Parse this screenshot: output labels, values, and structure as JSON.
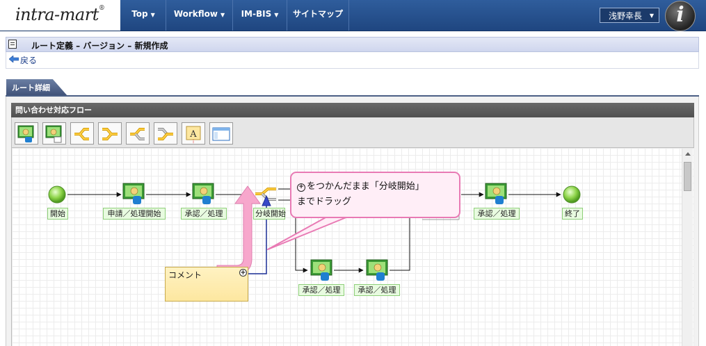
{
  "header": {
    "logo_text": "intra-mart",
    "nav": [
      {
        "label": "Top"
      },
      {
        "label": "Workflow"
      },
      {
        "label": "IM-BIS"
      },
      {
        "label": "サイトマップ"
      }
    ],
    "user_name": "浅野幸長",
    "avatar_letter": "i"
  },
  "page": {
    "title": "ルート定義 – バージョン – 新規作成",
    "back_label": "戻る",
    "tab_label": "ルート詳細",
    "flow_title": "問い合わせ対応フロー"
  },
  "toolbar": {
    "buttons": [
      {
        "icon": "process-node-icon"
      },
      {
        "icon": "approval-node-icon"
      },
      {
        "icon": "branch-start-icon"
      },
      {
        "icon": "branch-end-icon"
      },
      {
        "icon": "horizontal-branch-start-icon"
      },
      {
        "icon": "horizontal-branch-end-icon"
      },
      {
        "icon": "comment-text-icon"
      },
      {
        "icon": "window-icon"
      }
    ]
  },
  "flow": {
    "nodes": [
      {
        "label": "開始"
      },
      {
        "label": "申請／処理開始"
      },
      {
        "label": "承認／処理"
      },
      {
        "label": "分岐開始"
      },
      {
        "label": "承認／処理"
      },
      {
        "label": "終了"
      },
      {
        "label": "承認／処理"
      },
      {
        "label": "承認／処理"
      }
    ],
    "comment": {
      "text": "コメント",
      "plus": "+"
    }
  },
  "callout": {
    "plus": "+",
    "line1": "をつかんだまま「分岐開始」",
    "line2": "までドラッグ"
  },
  "colors": {
    "nav_bg": "#1f4680",
    "callout_border": "#e87ab4",
    "callout_bg": "#ffeef7",
    "node_label_bg": "#e8fbe0",
    "comment_bg": "#fde7a0",
    "arrow_pink": "#f39ac4",
    "connector_blue": "#1b2f96"
  }
}
